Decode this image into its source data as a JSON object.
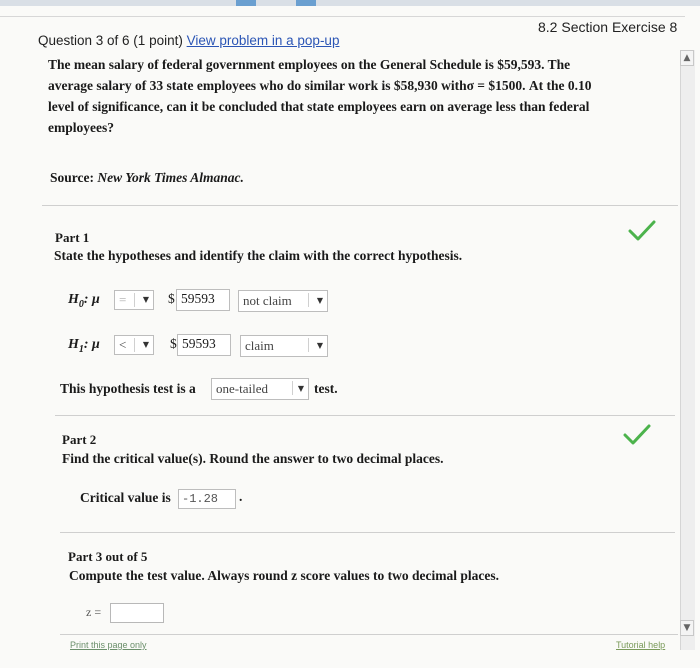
{
  "header": {
    "section_title": "8.2 Section Exercise 8",
    "question_label": "Question 3 of 6 (1 point)",
    "popup_link": "View problem in a pop-up"
  },
  "problem": {
    "line1": "The mean salary of federal government employees on the General Schedule is $59,593. The",
    "line2": "average salary of 33 state employees who do similar work is $58,930 withσ = $1500. At the 0.10",
    "line3": "level of significance, can it be concluded that state employees earn on average less than federal",
    "line4": "employees?",
    "source_label": "Source:",
    "source_name": "New York Times Almanac."
  },
  "part1": {
    "heading": "Part 1",
    "instruction": "State the hypotheses and identify the claim with the correct hypothesis.",
    "h0_label": "H",
    "h0_sub": "0",
    "h0_suffix": ": μ",
    "h0_operator": "=",
    "h0_currency": "$",
    "h0_value": "59593",
    "h0_claim": "not claim",
    "h1_label": "H",
    "h1_sub": "1",
    "h1_suffix": ": μ",
    "h1_operator": "<",
    "h1_currency": "$",
    "h1_value": "59593",
    "h1_claim": "claim",
    "test_prefix": "This hypothesis test is a",
    "test_type": "one-tailed",
    "test_suffix": "test."
  },
  "part2": {
    "heading": "Part 2",
    "instruction": "Find the critical value(s). Round the answer to two decimal places.",
    "critical_label": "Critical value is",
    "critical_value": "-1.28",
    "critical_suffix": "."
  },
  "part3": {
    "heading": "Part 3 out of 5",
    "instruction": "Compute the test value. Always round z score values to two decimal places.",
    "z_label": "z ="
  },
  "footer": {
    "print_link": "Print this page only",
    "tutorial_link": "Tutorial help"
  },
  "colors": {
    "check_green": "#4cb34c",
    "link_blue": "#2b55b5"
  }
}
